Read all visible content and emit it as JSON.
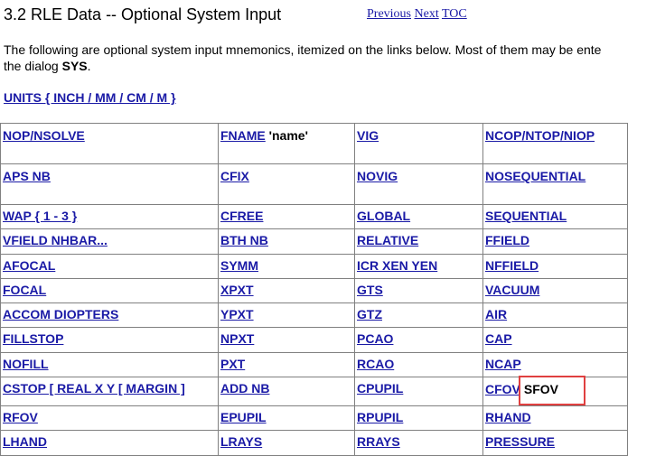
{
  "header": {
    "title": "3.2 RLE Data -- Optional System Input",
    "nav": {
      "previous": "Previous",
      "next": "Next",
      "toc": "TOC"
    }
  },
  "intro": {
    "text": "The following are optional system input mnemonics, itemized on the links below.  Most of them may be ente",
    "line2_prefix": "the dialog ",
    "line2_bold": "SYS",
    "line2_suffix": "."
  },
  "units_link": "UNITS { INCH / MM / CM / M }",
  "table": {
    "rows": [
      {
        "c1": "NOP/NSOLVE",
        "c2": "FNAME",
        "c2_extra": "'name'",
        "c3": "VIG",
        "c4": "NCOP/NTOP/NIOP"
      },
      {
        "c1": "APS NB",
        "c2": "CFIX",
        "c3": "NOVIG",
        "c4": "NOSEQUENTIAL"
      },
      {
        "c1": "WAP { 1 - 3 }",
        "c2": "CFREE",
        "c3": "GLOBAL",
        "c4": "SEQUENTIAL"
      },
      {
        "c1": "VFIELD NHBAR...",
        "c2": "BTH NB",
        "c3": "RELATIVE",
        "c4": "FFIELD"
      },
      {
        "c1": "AFOCAL",
        "c2": "SYMM",
        "c3": "ICR XEN YEN",
        "c4": "NFFIELD"
      },
      {
        "c1": "FOCAL",
        "c2": "XPXT",
        "c3": "GTS",
        "c4": "VACUUM"
      },
      {
        "c1": "ACCOM DIOPTERS",
        "c2": "YPXT",
        "c3": "GTZ",
        "c4": "AIR"
      },
      {
        "c1": "FILLSTOP",
        "c2": "NPXT",
        "c3": "PCAO",
        "c4": "CAP"
      },
      {
        "c1": "NOFILL",
        "c2": "PXT",
        "c3": "RCAO",
        "c4": "NCAP"
      },
      {
        "c1": "CSTOP [ REAL X Y [ MARGIN ]",
        "c2": "ADD NB",
        "c3": "CPUPIL",
        "c4": "CFOV",
        "c4_extra": "SFOV"
      },
      {
        "c1": "RFOV",
        "c2": "EPUPIL",
        "c3": "RPUPIL",
        "c4": "RHAND"
      },
      {
        "c1": "LHAND",
        "c2": "LRAYS",
        "c3": "RRAYS",
        "c4": "PRESSURE"
      }
    ]
  }
}
